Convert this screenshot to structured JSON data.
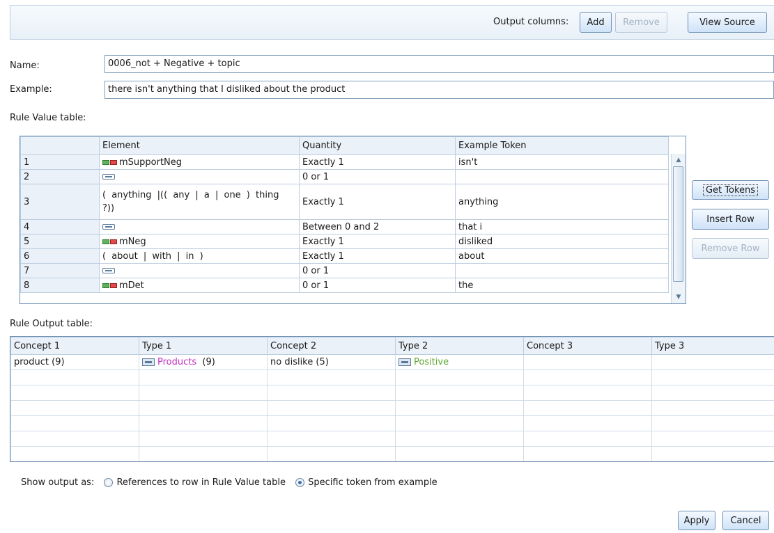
{
  "toolbar": {
    "output_columns_label": "Output columns:",
    "add_label": "Add",
    "remove_label": "Remove",
    "view_source_label": "View Source"
  },
  "form": {
    "name_label": "Name:",
    "name_value": "0006_not + Negative + topic",
    "example_label": "Example:",
    "example_value": "there isn't anything that I disliked about the product"
  },
  "rule_value": {
    "title": "Rule Value table:",
    "headers": [
      "",
      "Element",
      "Quantity",
      "Example Token"
    ],
    "rows": [
      {
        "num": "1",
        "element_icon": "concept-icon",
        "element": "mSupportNeg",
        "quantity": "Exactly 1",
        "token": "isn't"
      },
      {
        "num": "2",
        "element_icon": "token-icon",
        "element": "",
        "quantity": "0 or 1",
        "token": ""
      },
      {
        "num": "3",
        "element_icon": "",
        "element": "( anything |(( any | a | one ) thing ?))",
        "quantity": "Exactly 1",
        "token": "anything"
      },
      {
        "num": "4",
        "element_icon": "token-icon",
        "element": "",
        "quantity": "Between 0 and 2",
        "token": "that i"
      },
      {
        "num": "5",
        "element_icon": "concept-icon",
        "element": "mNeg",
        "quantity": "Exactly 1",
        "token": "disliked"
      },
      {
        "num": "6",
        "element_icon": "",
        "element": "( about | with | in )",
        "quantity": "Exactly 1",
        "token": "about"
      },
      {
        "num": "7",
        "element_icon": "token-icon",
        "element": "",
        "quantity": "0 or 1",
        "token": ""
      },
      {
        "num": "8",
        "element_icon": "concept-icon",
        "element": "mDet",
        "quantity": "0 or 1",
        "token": "the"
      }
    ],
    "get_tokens_label": "Get Tokens",
    "insert_row_label": "Insert Row",
    "remove_row_label": "Remove Row"
  },
  "rule_output": {
    "title": "Rule Output table:",
    "headers": [
      "Concept 1",
      "Type 1",
      "Concept 2",
      "Type 2",
      "Concept 3",
      "Type 3"
    ],
    "row": {
      "concept1": "product  (9)",
      "type1": "Products",
      "type1_count": "  (9)",
      "concept2": "no dislike  (5)",
      "type2": "Positive",
      "concept3": "",
      "type3": ""
    },
    "type1_color": "#c030c0",
    "type2_color": "#5fa832"
  },
  "show_output": {
    "label": "Show output as:",
    "option1": "References to row in Rule Value table",
    "option2": "Specific token from example",
    "selected": "option2"
  },
  "footer": {
    "apply_label": "Apply",
    "cancel_label": "Cancel"
  }
}
